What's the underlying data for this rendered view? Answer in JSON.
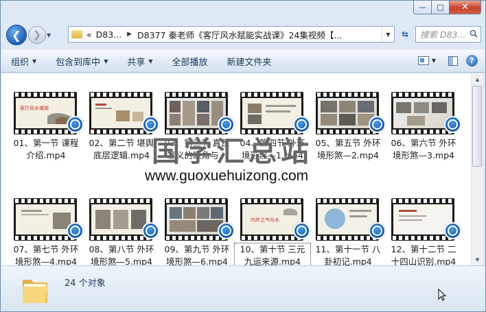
{
  "window": {
    "buttons": {
      "minimize": "—",
      "maximize": "□",
      "close": "✕"
    }
  },
  "nav": {
    "breadcrumb": [
      "D83...",
      "D8377 秦老师《客厅风水赋能实战课》24集视频【..."
    ],
    "search_placeholder": "搜索 D83..."
  },
  "toolbar": {
    "organize": "组织",
    "include_library": "包含到库中",
    "share": "共享",
    "play_all": "全部播放",
    "new_folder": "新建文件夹"
  },
  "files": [
    {
      "name": "01、第一节 课程介绍.mp4"
    },
    {
      "name": "02、第二节 堪舆底层逻辑.mp4"
    },
    {
      "name": "03、第三节 真正意义的缺角与..."
    },
    {
      "name": "04、第四节 外环境形煞—1.mp4"
    },
    {
      "name": "05、第五节 外环境形煞—2.mp4"
    },
    {
      "name": "06、第六节 外环境形煞—3.mp4"
    },
    {
      "name": "07、第七节 外环境形煞—4.mp4"
    },
    {
      "name": "08、第八节 外环境形煞—5.mp4"
    },
    {
      "name": "09、第九节 外环境形煞—6.mp4"
    },
    {
      "name": "10、第十节 三元九运来源.mp4"
    },
    {
      "name": "11、第十一节 八卦初记.mp4"
    },
    {
      "name": "12、第十二节 二十四山识别.mp4"
    }
  ],
  "thumb_titles": {
    "t1": "客厅风水堪舆",
    "t10": "内外之气与水"
  },
  "watermark": {
    "cn": "国学汇总站",
    "url": "www.guoxuehuizong.com"
  },
  "status": {
    "count": "24 个对象"
  }
}
